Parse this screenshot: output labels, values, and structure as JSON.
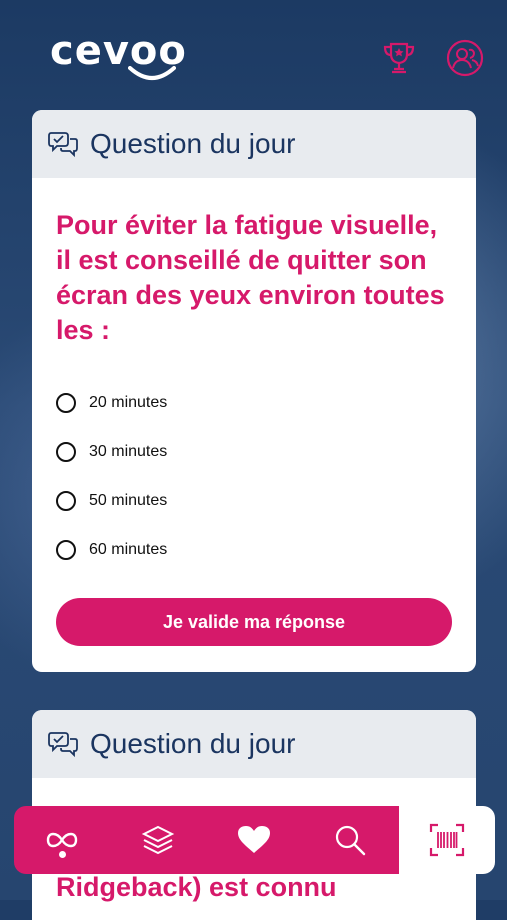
{
  "app": {
    "logo_text": "cevoo"
  },
  "header": {
    "trophy_icon": "trophy-icon",
    "profile_icon": "profile-icon"
  },
  "card1": {
    "header_title": "Question du jour",
    "question": "Pour éviter la fatigue visuelle, il est conseillé de quitter son écran des yeux environ toutes les :",
    "options": [
      "20 minutes",
      "30 minutes",
      "50 minutes",
      "60 minutes"
    ],
    "submit_label": "Je valide ma réponse"
  },
  "card2": {
    "header_title": "Question du jour",
    "partial_text": "Ridgeback) est connu"
  },
  "colors": {
    "accent": "#d6196a",
    "navy": "#1b3560"
  },
  "navbar": {
    "items": [
      "home-infinity-icon",
      "layers-icon",
      "heart-icon",
      "search-icon"
    ],
    "active": "home-infinity-icon",
    "scan_icon": "barcode-scan-icon"
  }
}
